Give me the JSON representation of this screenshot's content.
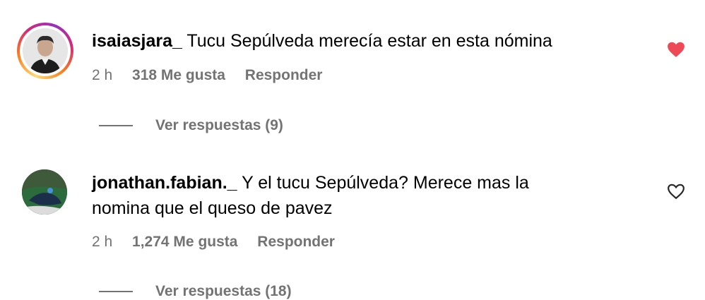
{
  "comments": [
    {
      "username": "isaiasjara_",
      "text": "Tucu Sepúlveda merecía estar en esta nómina",
      "time": "2 h",
      "likes": "318 Me gusta",
      "reply": "Responder",
      "view_replies": "Ver respuestas (9)",
      "liked": true,
      "heart_color": "#ed4956"
    },
    {
      "username": "jonathan.fabian._",
      "text_line1": "Y el tucu Sepúlveda? Merece mas la",
      "text_line2": "nomina que el queso de pavez",
      "time": "2 h",
      "likes": "1,274 Me gusta",
      "reply": "Responder",
      "view_replies": "Ver respuestas (18)",
      "liked": false
    }
  ]
}
